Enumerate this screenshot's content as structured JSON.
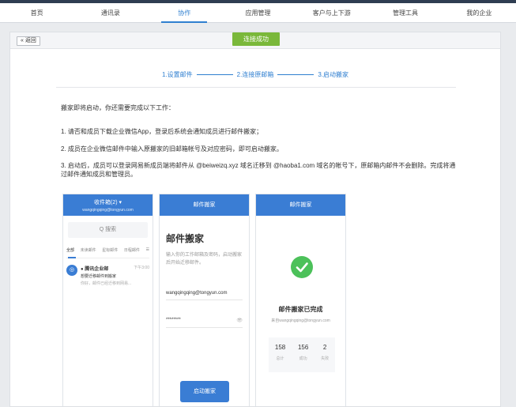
{
  "nav": {
    "items": [
      {
        "label": "首页"
      },
      {
        "label": "通讯录"
      },
      {
        "label": "协作"
      },
      {
        "label": "应用管理"
      },
      {
        "label": "客户与上下游"
      },
      {
        "label": "管理工具"
      },
      {
        "label": "我的企业"
      }
    ],
    "active_index": 2
  },
  "toolbar": {
    "back_label": "« 返回",
    "status_badge": "连接成功"
  },
  "steps": {
    "step1": "1.设置邮件",
    "step2": "2.连接原邮箱",
    "step3": "3.启动搬家"
  },
  "main": {
    "intro": "搬家即将启动，你还需要完成以下工作：",
    "tip1": "1. 请否和成员下载企业微信App，登录后系统会通知成员进行邮件搬家；",
    "tip2": "2. 成员在企业微信邮件中输入原搬家的旧邮箱帐号及对应密码，即可启动搬家。",
    "tip3": "3. 启动后，成员可以登录网易新成员端将邮件从 @beiweizq.xyz 域名迁移到 @haoba1.com 域名的帐号下，原邮箱内邮件不会删除。完成将通过邮件通知成员和管理员。"
  },
  "phone1": {
    "title": "收件箱(2) ▾",
    "subtitle": "wangqingqing@tongyun.com",
    "search": "Q 搜索",
    "tabs": [
      "全部",
      "未读邮件",
      "星标邮件",
      "日程邮件",
      "☰"
    ],
    "mail": {
      "avatar": "◎",
      "from": "● 腾讯企业邮",
      "time": "下午3:00",
      "subject": "想要迁移邮件到搬家",
      "preview": "你好，邮件已经迁移到网易..."
    }
  },
  "phone2": {
    "header": "邮件搬家",
    "title": "邮件搬家",
    "desc": "输入你的工作邮箱及密码，启动搬家后开始迁移邮件。",
    "account": "wangqingqing@tongyun.com",
    "password": "********",
    "eye": "👁",
    "button": "启动搬家"
  },
  "phone3": {
    "header": "邮件搬家",
    "done_title": "邮件搬家已完成",
    "done_sub": "来自wangqingqing@tongyun.com",
    "stats": [
      {
        "num": "158",
        "label": "总计"
      },
      {
        "num": "156",
        "label": "成功"
      },
      {
        "num": "2",
        "label": "失败"
      }
    ]
  },
  "colors": {
    "accent": "#2f7fd0",
    "header_blue": "#3a7dd4",
    "success_green": "#7ab83a",
    "check_green": "#4cc15a"
  }
}
